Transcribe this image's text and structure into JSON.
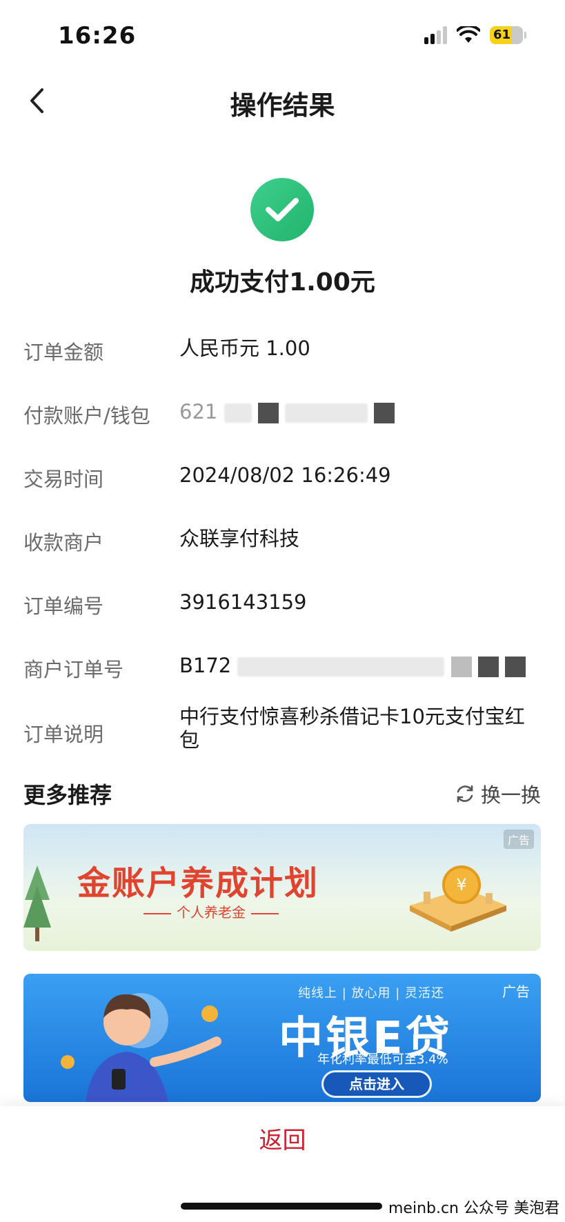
{
  "status_bar": {
    "time": "16:26",
    "battery": "61"
  },
  "nav": {
    "title": "操作结果"
  },
  "result": {
    "text": "成功支付1.00元"
  },
  "details": [
    {
      "label": "订单金额",
      "value": "人民币元 1.00"
    },
    {
      "label": "付款账户/钱包",
      "value": "621"
    },
    {
      "label": "交易时间",
      "value": "2024/08/02 16:26:49"
    },
    {
      "label": "收款商户",
      "value": "众联享付科技"
    },
    {
      "label": "订单编号",
      "value": "3916143159"
    },
    {
      "label": "商户订单号",
      "value": "B172"
    },
    {
      "label": "订单说明",
      "value": "中行支付惊喜秒杀借记卡10元支付宝红包"
    }
  ],
  "more": {
    "title": "更多推荐",
    "refresh_label": "换一换"
  },
  "banners": [
    {
      "title": "金账户养成计划",
      "subtitle": "个人养老金",
      "ad": "广告"
    },
    {
      "tagline": "纯线上 | 放心用 | 灵活还",
      "title": "中银E贷",
      "rate": "年化利率最低可至3.4%",
      "cta": "点击进入",
      "ad": "广告"
    }
  ],
  "footer": {
    "return_label": "返回",
    "watermark": "meinb.cn  公众号 美泡君"
  },
  "colors": {
    "success": "#20b46c",
    "return": "#cc1f2f"
  }
}
